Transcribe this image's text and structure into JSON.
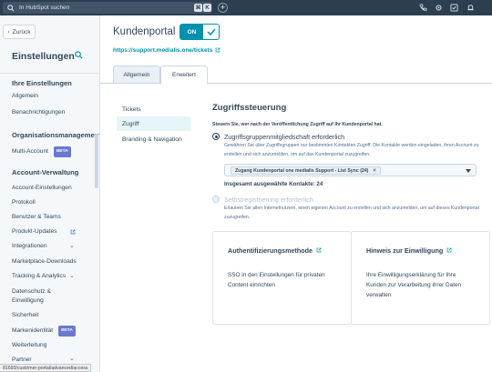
{
  "topbar": {
    "search_placeholder": "In HubSpot suchen",
    "kbd_cmd": "⌘",
    "kbd_k": "K",
    "plus": "+"
  },
  "sidebar": {
    "back_label": "Zurück",
    "title": "Einstellungen",
    "sections": [
      {
        "heading": "Ihre Einstellungen",
        "items": [
          "Allgemein",
          "Benachrichtigungen"
        ]
      },
      {
        "heading": "Organisationsmanagement",
        "items": [
          "Multi-Account"
        ]
      },
      {
        "heading": "Account-Verwaltung",
        "items": [
          "Account-Einstellungen",
          "Protokoll",
          "Benutzer & Teams",
          "Produkt-Updates",
          "Integrationen",
          "Marketplace-Downloads",
          "Tracking & Analytics",
          "Datenschutz &",
          "Einwilligung",
          "Sicherheit",
          "Markenidentität",
          "Weiterleitung",
          "Partner"
        ]
      }
    ],
    "beta": "BETA"
  },
  "header": {
    "title": "Kundenportal",
    "toggle_on": "ON",
    "url": "https://support.medialis.one/tickets"
  },
  "tabs": [
    "Allgemein",
    "Erweitert"
  ],
  "subnav": [
    "Tickets",
    "Zugriff",
    "Branding & Navigation"
  ],
  "access": {
    "heading": "Zugriffssteuerung",
    "description": "Steuern Sie, wer nach der Veröffentlichung Zugriff auf Ihr Kundenportal hat.",
    "option1": {
      "label": "Zugriffsgruppenmitgliedschaft erforderlich",
      "desc": "Gewähren Sie über Zugriffsgruppen nur bestimmten Kontakten Zugriff. Die Kontakte werden eingeladen, ihren Account zu erstellen und sich anzumelden, um auf das Kundenportal zuzugreifen.",
      "selected_tag": "Zugang Kundenportal one medialis Support - List Sync (24)",
      "tag_remove": "×",
      "total": "Insgesamt ausgewählte Kontakte: 24"
    },
    "option2": {
      "label": "Selbstregistrierung erforderlich",
      "desc": "Erlauben Sie allen Internetnutzern, einen eigenen Account zu erstellen und sich anzumelden, um auf dieses Kundenportal zuzugreifen."
    }
  },
  "cards": [
    {
      "title": "Authentifizierungsmethode",
      "body": "SSO in den Einstellungen für privaten Content einrichten"
    },
    {
      "title": "Hinweis zur Einwilligung",
      "body": "Ihre Einwilligungserklärung für Ihre Kunden zur Verarbeitung ihrer Daten verwalten"
    }
  ],
  "statusbar": "81693/customer-portal/advanced/access",
  "colors": {
    "accent": "#0091ae",
    "topbar": "#2d3e50",
    "beta": "#6a78d1"
  }
}
